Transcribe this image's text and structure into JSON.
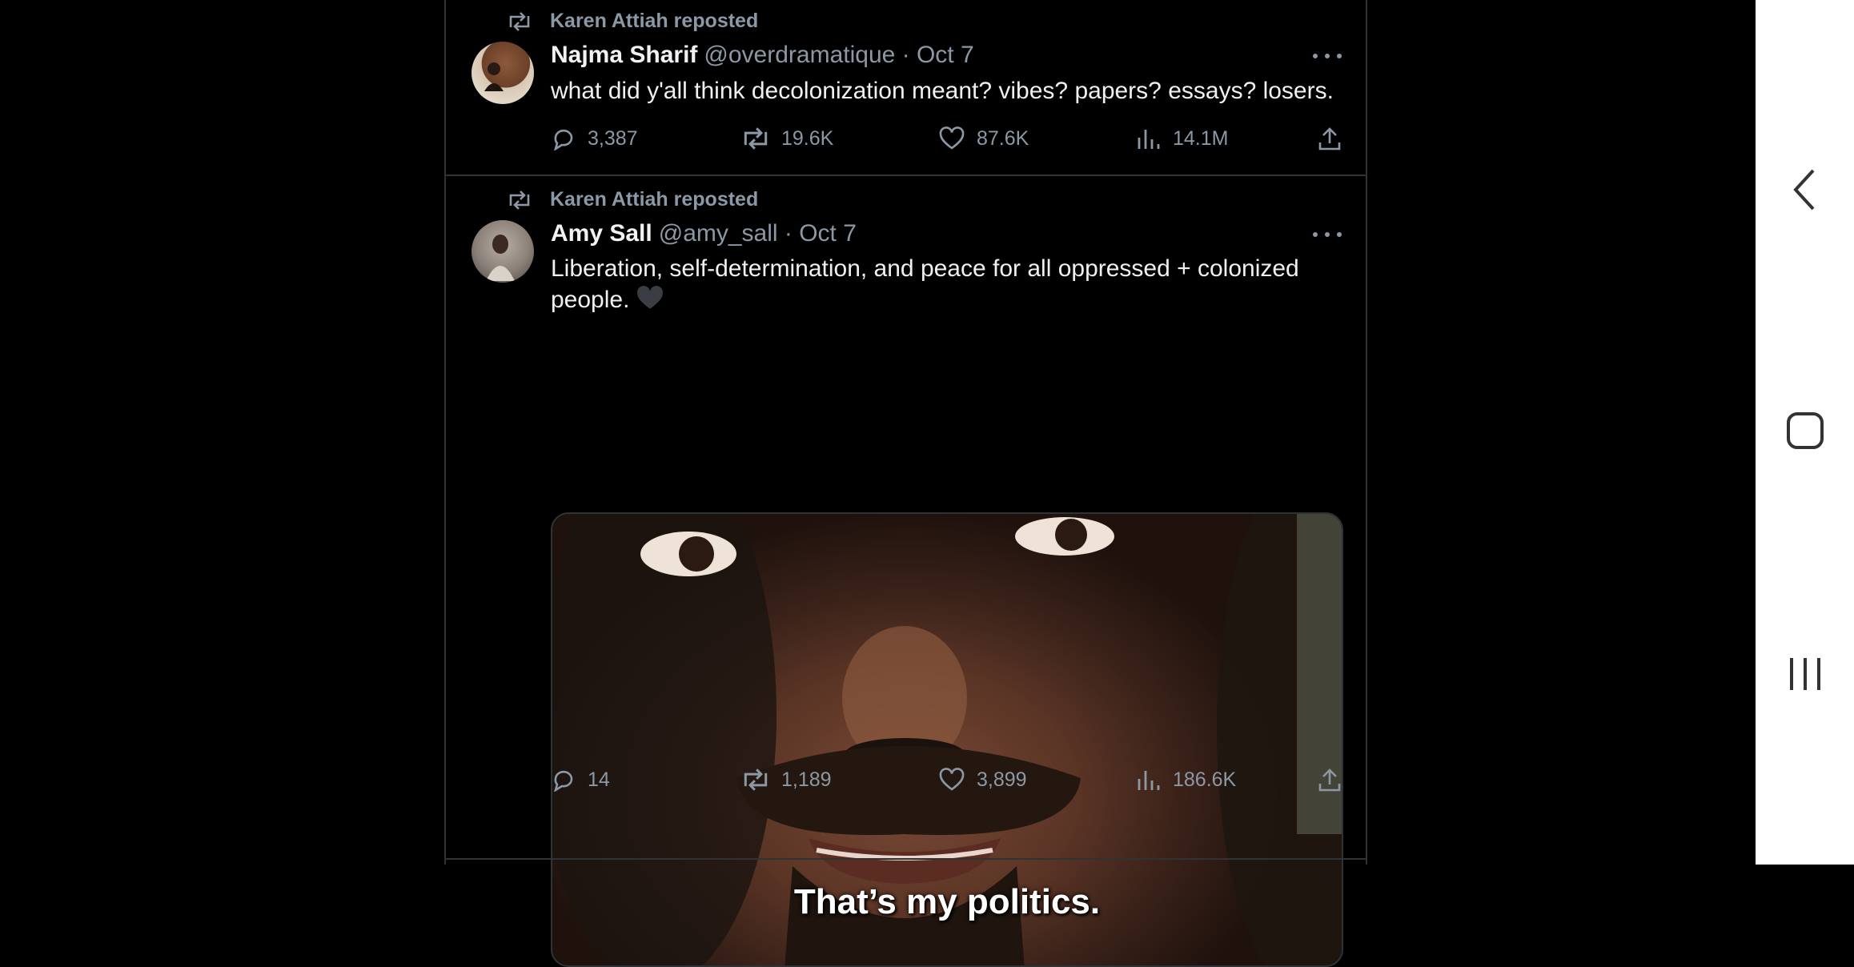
{
  "tweets": [
    {
      "repost_label": "Karen Attiah reposted",
      "name": "Najma Sharif",
      "handle_date": "@overdramatique · Oct 7",
      "text": "what did y'all think decolonization meant? vibes? papers? essays? losers.",
      "replies": "3,387",
      "reposts": "19.6K",
      "likes": "87.6K",
      "views": "14.1M"
    },
    {
      "repost_label": "Karen Attiah reposted",
      "name": "Amy Sall",
      "handle_date": "@amy_sall · Oct 7",
      "text_line1": "Liberation, self-determination, and peace for all oppressed + colonized",
      "text_line2": "people.",
      "media_caption": "That’s my politics.",
      "replies": "14",
      "reposts": "1,189",
      "likes": "3,899",
      "views": "186.6K"
    }
  ],
  "icons": {
    "repost": "repost-icon",
    "reply": "reply-icon",
    "like": "heart-icon",
    "views": "views-icon",
    "share": "share-icon",
    "more": "more-icon",
    "emoji": "black-heart-icon",
    "nav_back": "chevron-left-icon",
    "nav_home": "home-square-icon",
    "nav_recents": "recents-icon"
  },
  "colors": {
    "background": "#000000",
    "muted": "#8b98a5",
    "divider": "#2f3336",
    "navbar": "#ffffff"
  }
}
